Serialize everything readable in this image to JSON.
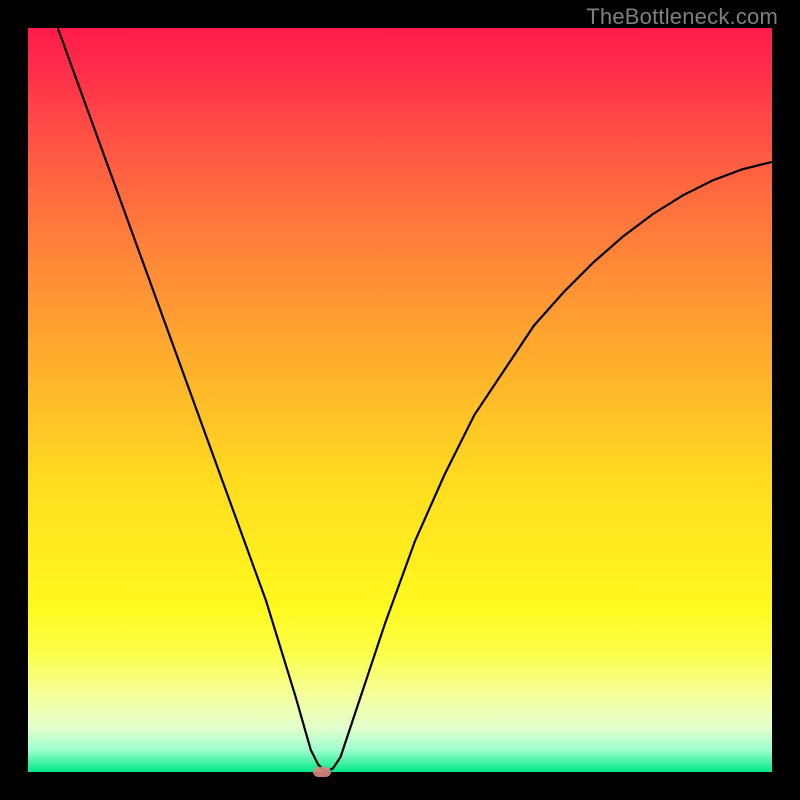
{
  "watermark": "TheBottleneck.com",
  "chart_data": {
    "type": "line",
    "title": "",
    "xlabel": "",
    "ylabel": "",
    "xlim": [
      0,
      100
    ],
    "ylim": [
      0,
      100
    ],
    "series": [
      {
        "name": "bottleneck-curve",
        "x": [
          4,
          8,
          12,
          16,
          20,
          24,
          28,
          32,
          36,
          38,
          39,
          40,
          41,
          42,
          44,
          48,
          52,
          56,
          60,
          64,
          68,
          72,
          76,
          80,
          84,
          88,
          92,
          96,
          100
        ],
        "y": [
          100,
          89,
          78,
          67,
          56,
          45,
          34,
          23,
          10,
          3,
          1,
          0,
          0.5,
          2,
          8,
          20,
          31,
          40,
          48,
          54,
          60,
          64.5,
          68.5,
          72,
          75,
          77.5,
          79.5,
          81,
          82
        ]
      }
    ],
    "marker": {
      "x": 39.5,
      "y": 0,
      "label": "optimal-point"
    },
    "grid": false,
    "legend": false,
    "colors": {
      "curve": "#000000",
      "background_top": "#ff1a4b",
      "background_bottom": "#00e786",
      "marker": "#d9867d"
    }
  }
}
